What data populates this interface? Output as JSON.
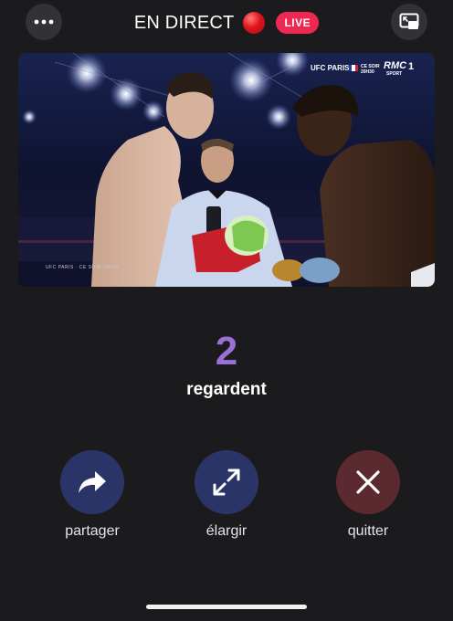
{
  "header": {
    "title": "EN DIRECT",
    "live_badge": "LIVE",
    "more_icon": "ellipsis-icon",
    "pip_icon": "picture-in-picture-icon"
  },
  "video": {
    "overlay": {
      "event": "UFC PARIS",
      "schedule": "CE SOIR 20H30",
      "channel": "RMC",
      "channel_sub": "SPORT",
      "channel_number": "1",
      "bottom_banner": "UFC PARIS · CE SOIR 20H30"
    }
  },
  "viewers": {
    "count": "2",
    "label": "regardent"
  },
  "actions": [
    {
      "label": "partager",
      "icon": "share-arrow-icon"
    },
    {
      "label": "élargir",
      "icon": "expand-icon"
    },
    {
      "label": "quitter",
      "icon": "close-icon"
    }
  ],
  "colors": {
    "background": "#1b1b1e",
    "accent_purple": "#9b6fd6",
    "live_badge": "#ee2850",
    "action_blue": "#2b3466",
    "action_red": "#5a2a30"
  }
}
